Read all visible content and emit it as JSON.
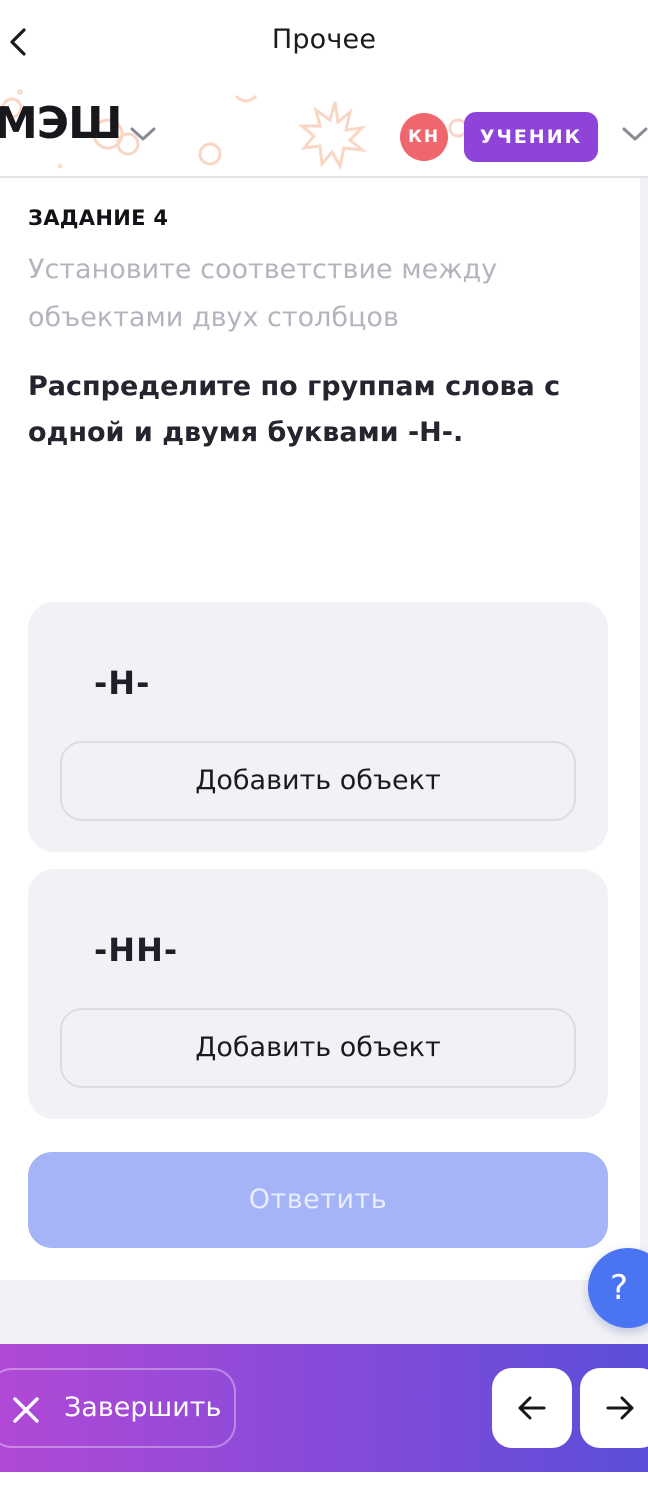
{
  "topnav": {
    "title": "Прочее",
    "back_icon": "chevron-left-icon"
  },
  "header": {
    "logo": "МЭШ",
    "avatar_initials": "КН",
    "role_label": "УЧЕНИК",
    "colors": {
      "avatar": "#f0666d",
      "role_badge": "#8e44d9"
    }
  },
  "task": {
    "number_label": "ЗАДАНИЕ 4",
    "type_text": "Установите соответствие между объектами двух столбцов",
    "question": "Распределите по группам слова с одной и двумя буквами -Н-."
  },
  "groups": [
    {
      "title": "-Н-",
      "add_label": "Добавить объект"
    },
    {
      "title": "-НН-",
      "add_label": "Добавить объект"
    }
  ],
  "submit": {
    "label": "Ответить",
    "enabled": false,
    "color": "#a4b4f6"
  },
  "help": {
    "label": "?"
  },
  "bottom_bar": {
    "finish_label": "Завершить",
    "finish_icon": "close-icon",
    "prev_icon": "arrow-left-icon",
    "next_icon": "arrow-right-icon"
  }
}
